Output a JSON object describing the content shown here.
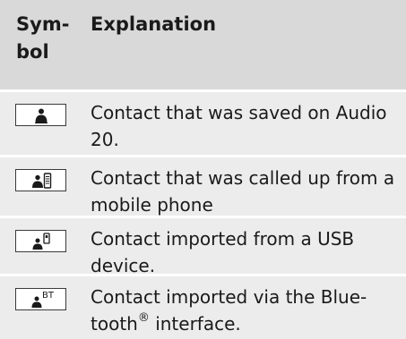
{
  "header": {
    "symbol": "Sym-\nbol",
    "explanation": "Explanation"
  },
  "rows": [
    {
      "icon": "contact-icon",
      "text_lines": [
        "Contact that was saved on Audio",
        "20."
      ]
    },
    {
      "icon": "contact-phone-icon",
      "text_lines": [
        "Contact that was called up from a",
        "mobile phone"
      ]
    },
    {
      "icon": "contact-usb-icon",
      "text_lines": [
        "Contact imported from a USB",
        "device."
      ]
    },
    {
      "icon": "contact-bluetooth-icon",
      "text_lines": [
        "Contact imported via the Blue-",
        "tooth"
      ],
      "superscript": "®",
      "text_after": " interface.",
      "icon_label": "BT"
    }
  ]
}
